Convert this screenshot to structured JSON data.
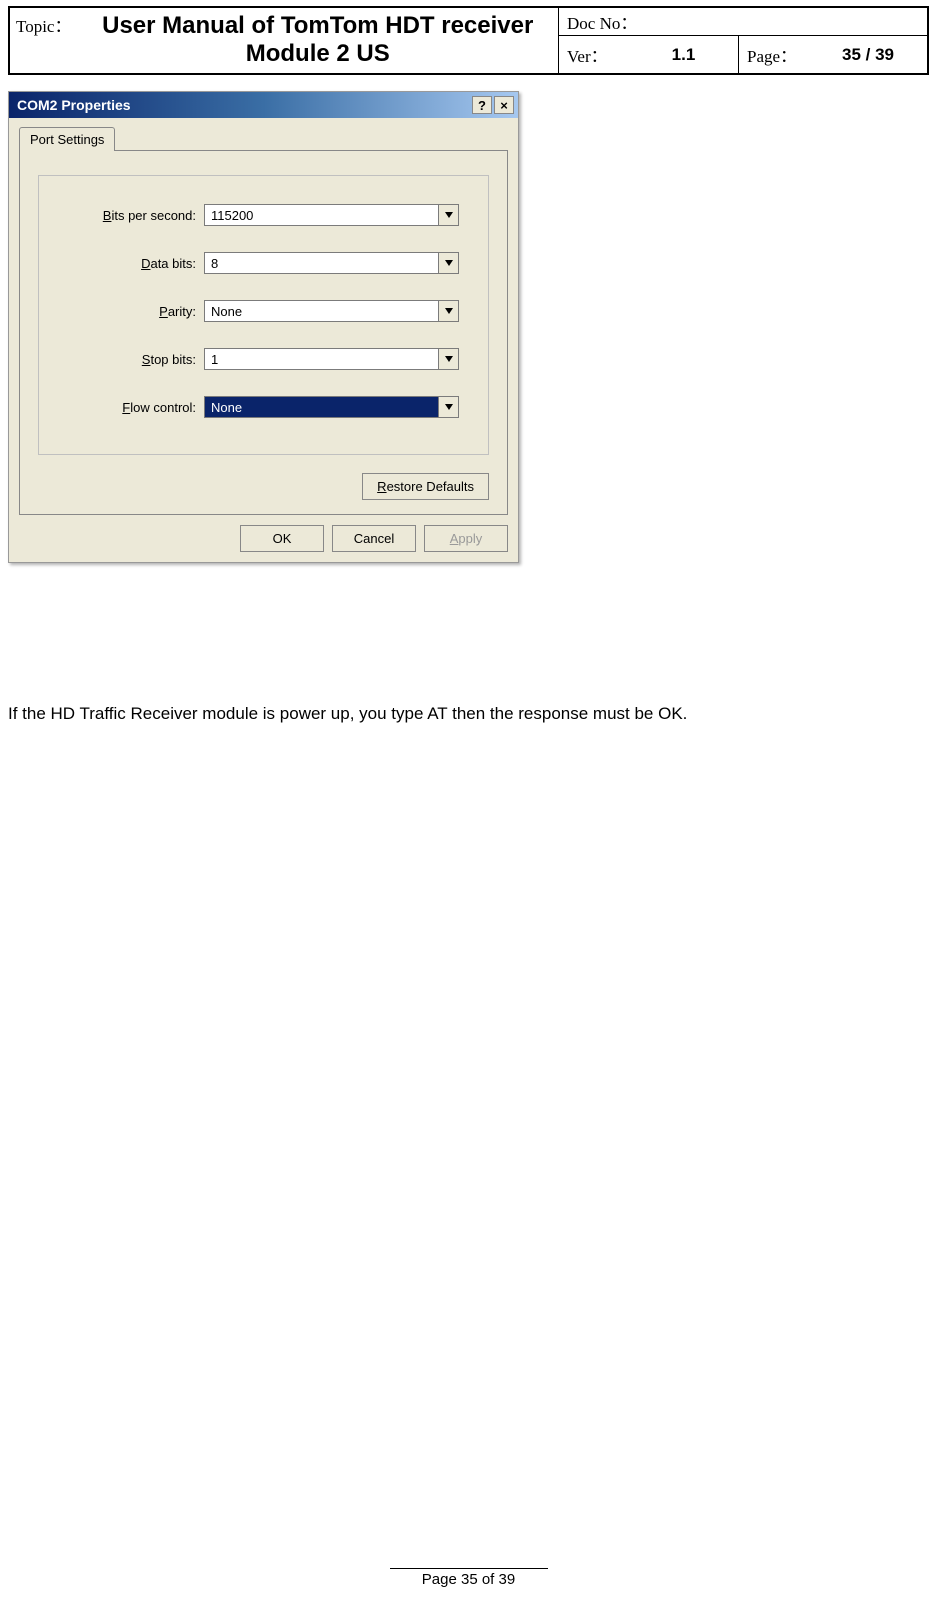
{
  "header": {
    "topic_label": "Topic：",
    "title": "User Manual of TomTom HDT receiver  Module 2 US",
    "docno_label": "Doc No：",
    "docno_value": "",
    "ver_label": "Ver：",
    "ver_value": "1.1",
    "page_label": "Page：",
    "page_value": "35 / 39"
  },
  "dialog": {
    "title": "COM2 Properties",
    "help_symbol": "?",
    "close_symbol": "×",
    "tab": "Port Settings",
    "fields": {
      "bits_per_second": {
        "label_pre": "B",
        "label_rest": "its per second:",
        "value": "115200"
      },
      "data_bits": {
        "label_pre": "D",
        "label_rest": "ata bits:",
        "value": "8"
      },
      "parity": {
        "label_pre": "P",
        "label_rest": "arity:",
        "value": "None"
      },
      "stop_bits": {
        "label_pre": "S",
        "label_rest": "top bits:",
        "value": "1"
      },
      "flow_control": {
        "label_pre": "F",
        "label_rest": "low control:",
        "value": "None"
      }
    },
    "restore_pre": "R",
    "restore_rest": "estore Defaults",
    "ok": "OK",
    "cancel": "Cancel",
    "apply_pre": "A",
    "apply_rest": "pply"
  },
  "body_text": "If the HD Traffic Receiver module is power up, you type AT then the response must be OK.",
  "footer": "Page 35 of 39"
}
